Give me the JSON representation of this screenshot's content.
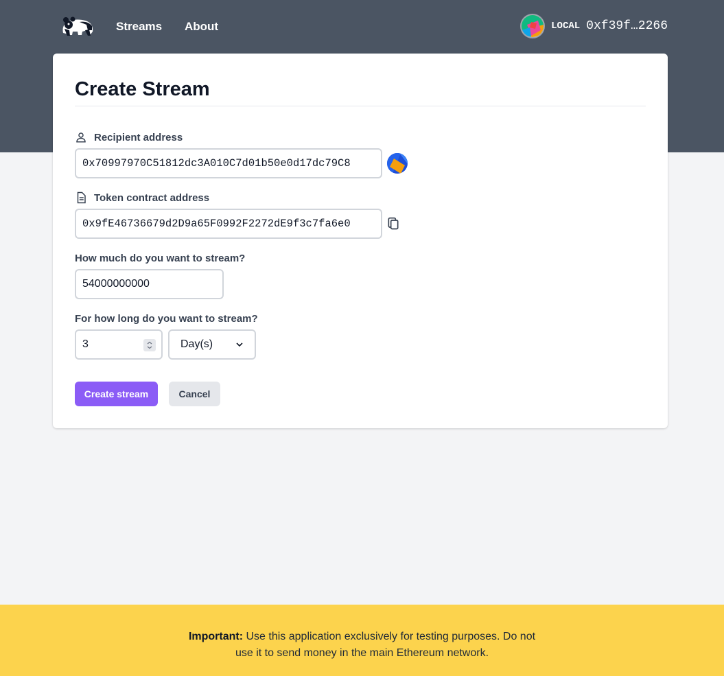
{
  "nav": {
    "logo_icon": "panda-logo-icon",
    "links": [
      {
        "label": "Streams"
      },
      {
        "label": "About"
      }
    ],
    "account": {
      "avatar_icon": "account-identicon-icon",
      "network": "LOCAL",
      "address": "0xf39f…2266"
    }
  },
  "form": {
    "title": "Create Stream",
    "recipient": {
      "label": "Recipient address",
      "icon": "user-icon",
      "value": "0x70997970C51812dc3A010C7d01b50e0d17dc79C8",
      "avatar_icon": "recipient-identicon-icon"
    },
    "token": {
      "label": "Token contract address",
      "icon": "document-icon",
      "value": "0x9fE46736679d2D9a65F0992F2272dE9f3c7fa6e0",
      "copy_icon": "copy-icon"
    },
    "amount": {
      "label": "How much do you want to stream?",
      "value": "54000000000"
    },
    "duration": {
      "label": "For how long do you want to stream?",
      "value": "3",
      "unit": "Day(s)"
    },
    "buttons": {
      "create": "Create stream",
      "cancel": "Cancel"
    }
  },
  "footer": {
    "important": "Important:",
    "message": "Use this application exclusively for testing purposes. Do not use it to send money in the main Ethereum network."
  },
  "colors": {
    "header_bg": "#4b5563",
    "accent": "#8b5cf6",
    "warning_bg": "#fcd34d",
    "page_bg": "#f3f4f6"
  }
}
